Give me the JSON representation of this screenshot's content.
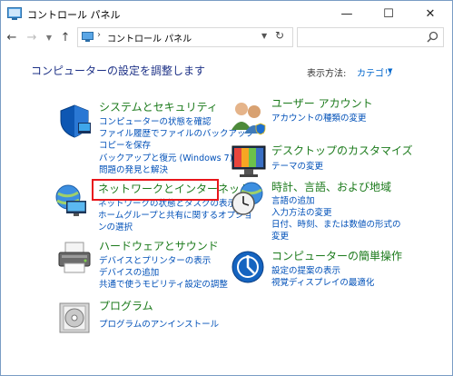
{
  "window": {
    "title": "コントロール パネル",
    "minimize": "—",
    "maximize": "☐",
    "close": "✕"
  },
  "address": {
    "path": "コントロール パネル",
    "separator": "›"
  },
  "header": {
    "heading": "コンピューターの設定を調整します",
    "view_by_label": "表示方法:",
    "view_by_value": "カテゴリ"
  },
  "categories": [
    {
      "title": "システムとセキュリティ",
      "icon": "shield-icon",
      "links": [
        "コンピューターの状態を確認",
        "ファイル履歴でファイルのバックアップ",
        "コピーを保存",
        "バックアップと復元 (Windows 7)",
        "問題の発見と解決"
      ]
    },
    {
      "title": "ネットワークとインターネット",
      "icon": "network-globe-icon",
      "links": [
        "ネットワークの状態とタスクの表示",
        "ホームグループと共有に関するオプショ",
        "ンの選択"
      ]
    },
    {
      "title": "ハードウェアとサウンド",
      "icon": "printer-icon",
      "links": [
        "デバイスとプリンターの表示",
        "デバイスの追加",
        "共通で使うモビリティ設定の調整"
      ]
    },
    {
      "title": "プログラム",
      "icon": "programs-disc-icon",
      "links": [
        "プログラムのアンインストール"
      ]
    },
    {
      "title": "ユーザー アカウント",
      "icon": "users-icon",
      "links": [
        "アカウントの種類の変更"
      ]
    },
    {
      "title": "デスクトップのカスタマイズ",
      "icon": "desktop-monitor-icon",
      "links": [
        "テーマの変更"
      ]
    },
    {
      "title": "時計、言語、および地域",
      "icon": "clock-globe-icon",
      "links": [
        "言語の追加",
        "入力方法の変更",
        "日付、時刻、または数値の形式の",
        "変更"
      ]
    },
    {
      "title": "コンピューターの簡単操作",
      "icon": "ease-of-access-icon",
      "links": [
        "設定の提案の表示",
        "視覚ディスプレイの最適化"
      ]
    }
  ],
  "colors": {
    "heading": "#1e3287",
    "category_title": "#1b7a1b",
    "link": "#0050b8",
    "highlight": "#e8161b"
  }
}
